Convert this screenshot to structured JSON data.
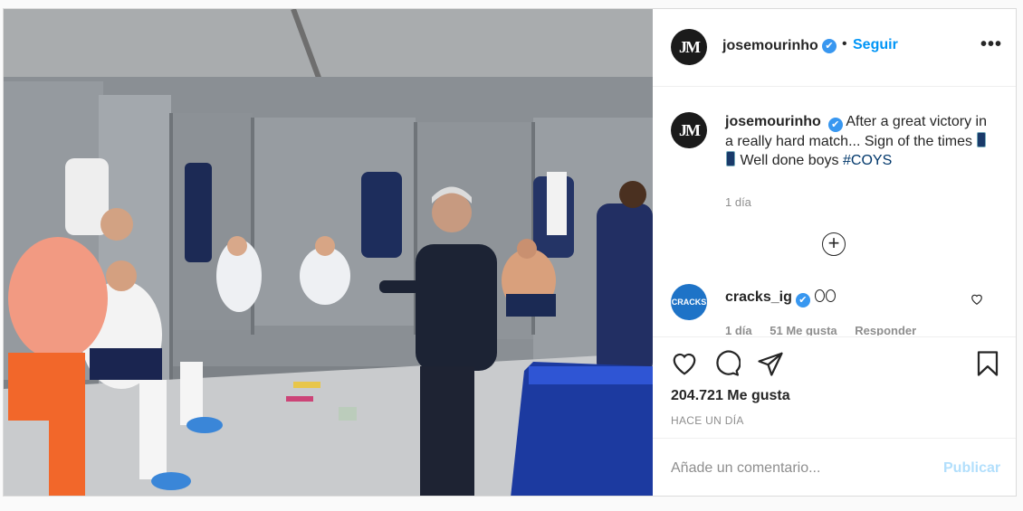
{
  "header": {
    "avatar_text": "JM",
    "username": "josemourinho",
    "verified_icon": "✔",
    "separator": "•",
    "follow_label": "Seguir",
    "more_label": "•••"
  },
  "caption": {
    "username": "josemourinho",
    "text_before": "After a great victory in a really hard match... Sign of the times",
    "text_after": "Well done boys",
    "hashtag": "#COYS",
    "timestamp": "1 día"
  },
  "comment": {
    "avatar_text": "CRACKS",
    "username": "cracks_ig",
    "time": "1 día",
    "likes": "51 Me gusta",
    "reply": "Responder"
  },
  "actions": {
    "likes_count": "204.721 Me gusta",
    "posted_ago": "HACE UN DÍA"
  },
  "add_comment": {
    "placeholder": "Añade un comentario...",
    "publish_label": "Publicar"
  },
  "colors": {
    "link_blue": "#0095f6",
    "verified_blue": "#3897f0",
    "hashtag_blue": "#00376b",
    "muted": "#8e8e8e",
    "publish_disabled": "#b2dffc"
  }
}
